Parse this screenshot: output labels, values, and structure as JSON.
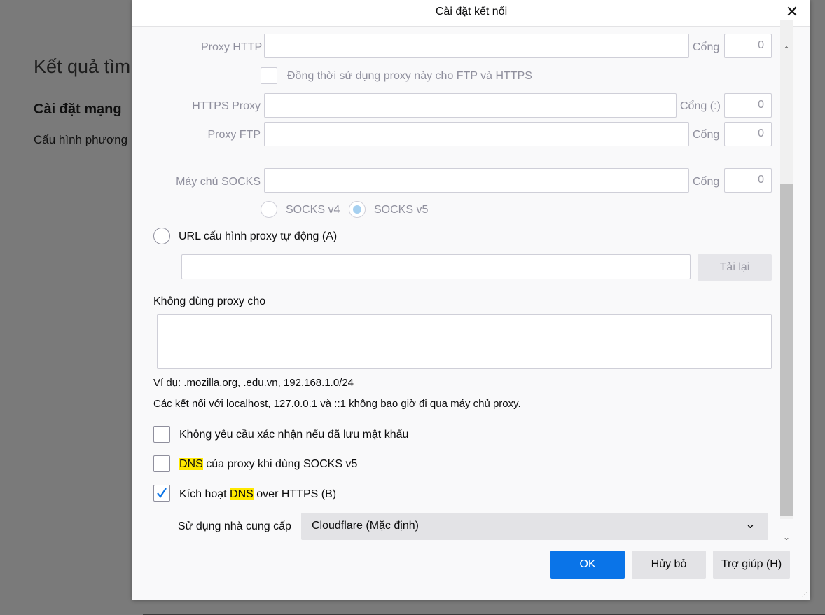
{
  "background": {
    "title": "Kết quả tìm",
    "heading": "Cài đặt mạng",
    "text": "Cấu hình phương"
  },
  "dialog": {
    "title": "Cài đặt kết nối",
    "close_icon": "close-icon"
  },
  "proxy": {
    "http_label": "Proxy HTTP",
    "http_port_label": "Cổng",
    "http_port_value": "0",
    "share_label": "Đồng thời sử dụng proxy này cho FTP và HTTPS",
    "https_label": "HTTPS Proxy",
    "https_port_label": "Cổng (:)",
    "https_port_value": "0",
    "ftp_label": "Proxy FTP",
    "ftp_port_label": "Cổng",
    "ftp_port_value": "0",
    "socks_label": "Máy chủ SOCKS",
    "socks_port_label": "Cổng",
    "socks_port_value": "0",
    "socks_v4": "SOCKS v4",
    "socks_v5": "SOCKS v5",
    "auto_url_label": "URL cấu hình proxy tự động (A)",
    "reload_button": "Tải lại"
  },
  "no_proxy": {
    "label": "Không dùng proxy cho",
    "example": "Ví dụ: .mozilla.org, .edu.vn, 192.168.1.0/24",
    "localhost_note": "Các kết nối với localhost, 127.0.0.1 và ::1 không bao giờ đi qua máy chủ proxy."
  },
  "options": {
    "no_prompt_auth": {
      "label": "Không yêu cầu xác nhận nếu đã lưu mật khẩu",
      "checked": false
    },
    "proxy_dns": {
      "highlight": "DNS",
      "rest": " của proxy khi dùng SOCKS v5",
      "checked": false
    },
    "doh": {
      "prefix": "Kích hoạt ",
      "highlight": "DNS",
      "rest": " over HTTPS (B)",
      "checked": true
    }
  },
  "provider": {
    "label": "Sử dụng nhà cung cấp",
    "value": "Cloudflare (Mặc định)"
  },
  "footer": {
    "ok": "OK",
    "cancel": "Hủy bỏ",
    "help": "Trợ giúp (H)"
  },
  "colors": {
    "primary": "#0a74e8",
    "highlight": "#ffe900"
  }
}
